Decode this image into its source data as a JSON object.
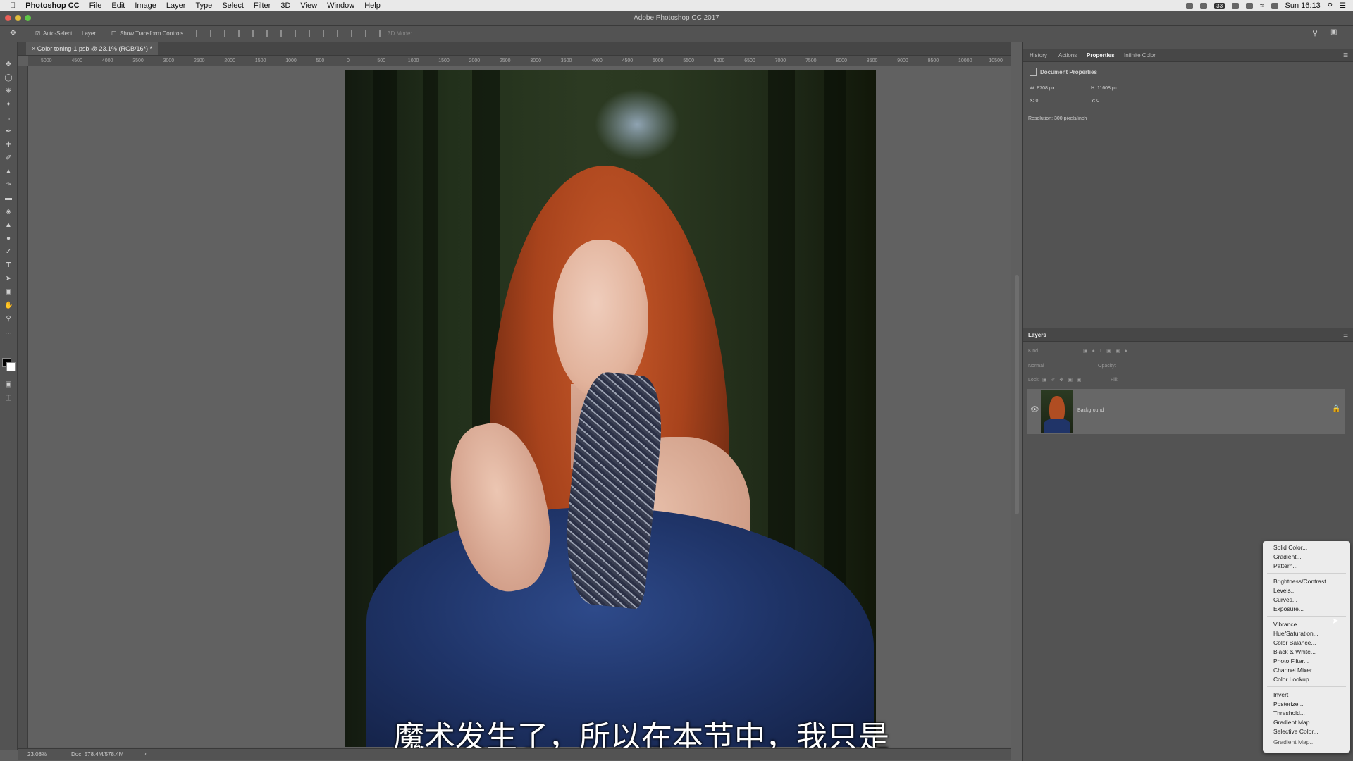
{
  "menubar": {
    "app_name": "Photoshop CC",
    "items": [
      "File",
      "Edit",
      "Image",
      "Layer",
      "Type",
      "Select",
      "Filter",
      "3D",
      "View",
      "Window",
      "Help"
    ],
    "battery": "33",
    "clock": "Sun 16:13"
  },
  "window": {
    "title": "Adobe Photoshop CC 2017"
  },
  "options_bar": {
    "auto_select_label": "Auto-Select:",
    "auto_select_target": "Layer",
    "show_transform_label": "Show Transform Controls",
    "mode_3d_label": "3D Mode:"
  },
  "document": {
    "tab_label": "Color toning-1.psb @ 23.1% (RGB/16*) *"
  },
  "ruler_ticks": [
    "5000",
    "4500",
    "4000",
    "3500",
    "3000",
    "2500",
    "2000",
    "1500",
    "1000",
    "500",
    "0",
    "500",
    "1000",
    "1500",
    "2000",
    "2500",
    "3000",
    "3500",
    "4000",
    "4500",
    "5000",
    "5500",
    "6000",
    "6500",
    "7000",
    "7500",
    "8000",
    "8500",
    "9000",
    "9500",
    "10000",
    "10500"
  ],
  "subtitle": "魔术发生了，所以在本节中，我只是",
  "status": {
    "zoom": "23.08%",
    "doc_size": "Doc: 578.4M/578.4M"
  },
  "properties_panel": {
    "tabs": [
      "History",
      "Actions",
      "Properties",
      "Infinite Color"
    ],
    "active_tab": "Properties",
    "section_title": "Document Properties",
    "width": "W: 8708 px",
    "height": "H: 11608 px",
    "x": "X: 0",
    "y": "Y: 0",
    "resolution": "Resolution: 300 pixels/inch"
  },
  "layers_panel": {
    "title": "Layers",
    "filter_placeholder": "Kind",
    "blend_mode": "Normal",
    "opacity_label": "Opacity:",
    "lock_label": "Lock:",
    "fill_label": "Fill:",
    "layers": [
      {
        "name": "Background",
        "visible": true,
        "locked": true
      }
    ]
  },
  "adjustment_menu": {
    "group1": [
      "Solid Color...",
      "Gradient...",
      "Pattern..."
    ],
    "group2": [
      "Brightness/Contrast...",
      "Levels...",
      "Curves...",
      "Exposure..."
    ],
    "group3": [
      "Vibrance...",
      "Hue/Saturation...",
      "Color Balance...",
      "Black & White...",
      "Photo Filter...",
      "Channel Mixer...",
      "Color Lookup..."
    ],
    "group4": [
      "Invert",
      "Posterize...",
      "Threshold...",
      "Gradient Map...",
      "Selective Color..."
    ],
    "overflow_item": "Gradient Map..."
  },
  "colors": {
    "ui_dark": "#535353",
    "canvas_bg": "#616161",
    "menu_bg": "#ececec",
    "hair": "#c75a2b",
    "dress": "#1f3468"
  }
}
